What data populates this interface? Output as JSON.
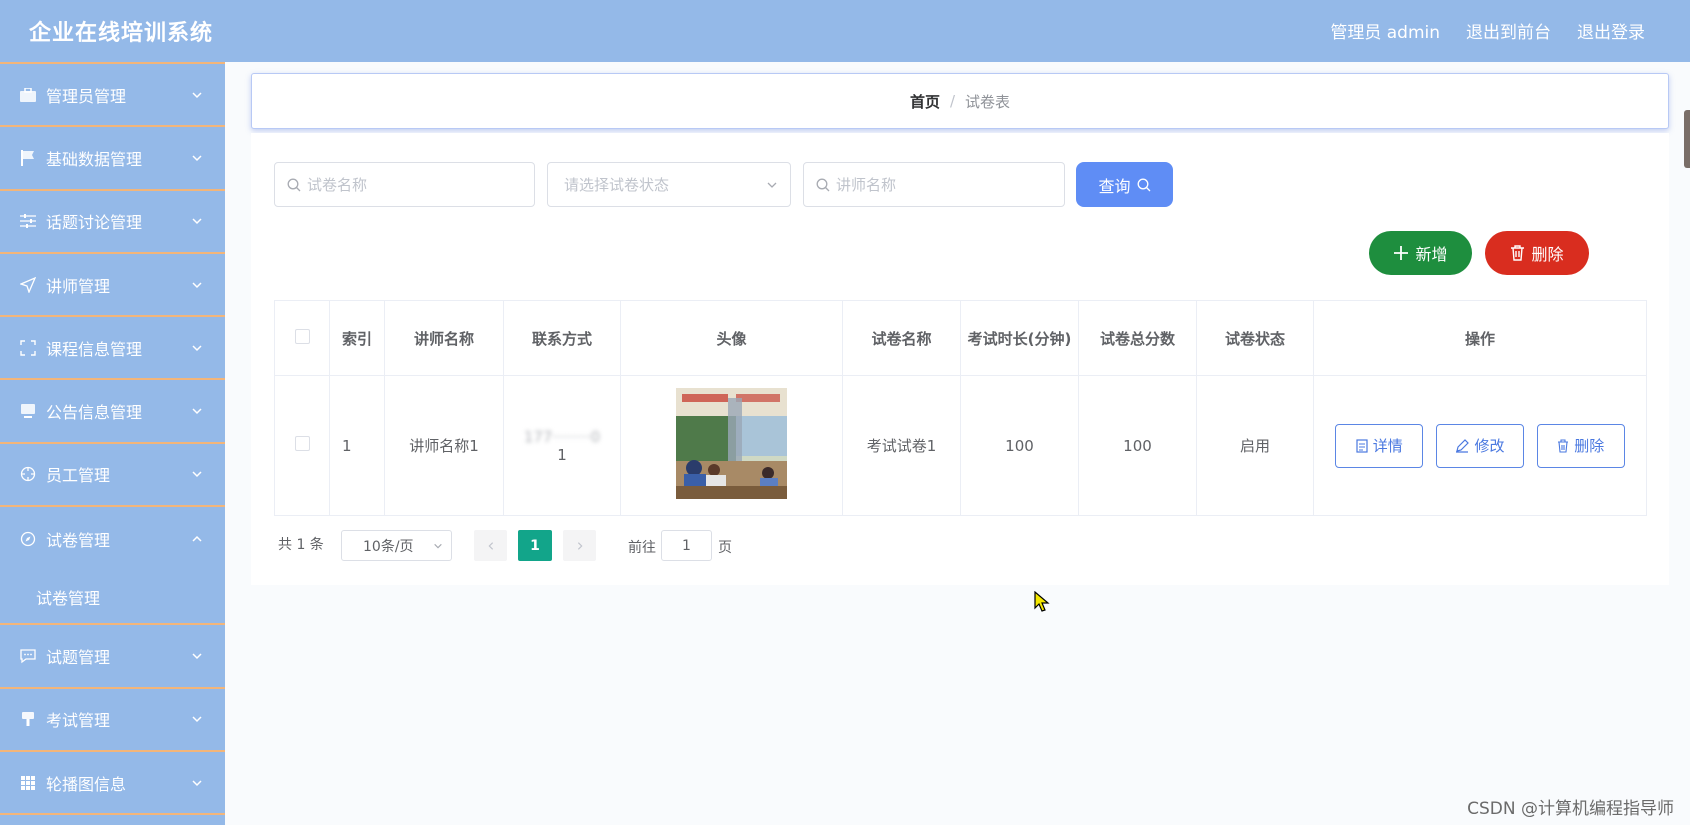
{
  "header": {
    "title": "企业在线培训系统",
    "links": [
      "管理员 admin",
      "退出到前台",
      "退出登录"
    ]
  },
  "sidebar": {
    "items": [
      {
        "label": "管理员管理",
        "icon": "briefcase-icon"
      },
      {
        "label": "基础数据管理",
        "icon": "flag-icon"
      },
      {
        "label": "话题讨论管理",
        "icon": "sliders-icon"
      },
      {
        "label": "讲师管理",
        "icon": "send-icon"
      },
      {
        "label": "课程信息管理",
        "icon": "fullscreen-icon"
      },
      {
        "label": "公告信息管理",
        "icon": "monitor-icon"
      },
      {
        "label": "员工管理",
        "icon": "crosshair-icon"
      },
      {
        "label": "试卷管理",
        "icon": "compass-icon",
        "expanded": true
      },
      {
        "label": "试题管理",
        "icon": "chat-icon"
      },
      {
        "label": "考试管理",
        "icon": "brush-icon"
      },
      {
        "label": "轮播图信息",
        "icon": "grid-icon"
      }
    ],
    "submenu_label": "试卷管理"
  },
  "breadcrumb": {
    "home": "首页",
    "separator": "/",
    "current": "试卷表"
  },
  "search": {
    "paper_name_placeholder": "试卷名称",
    "status_placeholder": "请选择试卷状态",
    "teacher_name_placeholder": "讲师名称",
    "query_label": "查询"
  },
  "actions": {
    "add_label": "新增",
    "delete_label": "删除"
  },
  "table": {
    "headers": [
      "索引",
      "讲师名称",
      "联系方式",
      "头像",
      "试卷名称",
      "考试时长(分钟)",
      "试卷总分数",
      "试卷状态",
      "操作"
    ],
    "rows": [
      {
        "index": "1",
        "teacher_name": "讲师名称1",
        "phone_line1": "177········0",
        "phone_line2": "1",
        "paper_name": "考试试卷1",
        "duration": "100",
        "total_score": "100",
        "status": "启用",
        "ops": [
          "详情",
          "修改",
          "删除"
        ]
      }
    ]
  },
  "pagination": {
    "total_text": "共 1 条",
    "page_size": "10条/页",
    "current_page": "1",
    "goto_label": "前往",
    "goto_value": "1",
    "goto_suffix": "页"
  },
  "watermark": "CSDN @计算机编程指导师",
  "colors": {
    "sidebar_bg": "#94b9e8",
    "divider": "#f2b57a",
    "query_btn": "#5f8df5",
    "add_btn": "#1e8e3e",
    "delete_btn": "#d92d1f",
    "page_active": "#12a58a"
  }
}
